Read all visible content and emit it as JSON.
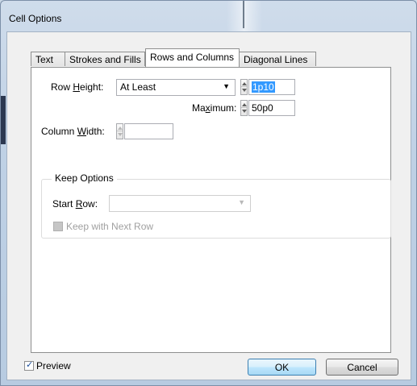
{
  "window": {
    "title": "Cell Options"
  },
  "tabs": [
    {
      "label": "Text"
    },
    {
      "label": "Strokes and Fills"
    },
    {
      "label": "Rows and Columns"
    },
    {
      "label": "Diagonal Lines"
    }
  ],
  "active_tab": "Rows and Columns",
  "row_height": {
    "label_pre": "Row ",
    "label_u": "H",
    "label_post": "eight:",
    "mode_value": "At Least",
    "value": "1p10"
  },
  "maximum": {
    "label_pre": "Ma",
    "label_u": "x",
    "label_post": "imum:",
    "value": "50p0"
  },
  "column_width": {
    "label_pre": "Column ",
    "label_u": "W",
    "label_post": "idth:",
    "value": ""
  },
  "keep_options": {
    "legend": "Keep Options",
    "start_row_pre": "Start ",
    "start_row_u": "R",
    "start_row_post": "ow:",
    "start_row_value": "",
    "keep_with_next_label": "Keep with Next Row",
    "keep_with_next_checked": false
  },
  "footer": {
    "preview_label": "Preview",
    "preview_checked": true,
    "ok_label": "OK",
    "cancel_label": "Cancel"
  },
  "colors": {
    "selection": "#3399ff",
    "default_button": "#bee6fd",
    "disabled_text": "#a0a0a0"
  }
}
